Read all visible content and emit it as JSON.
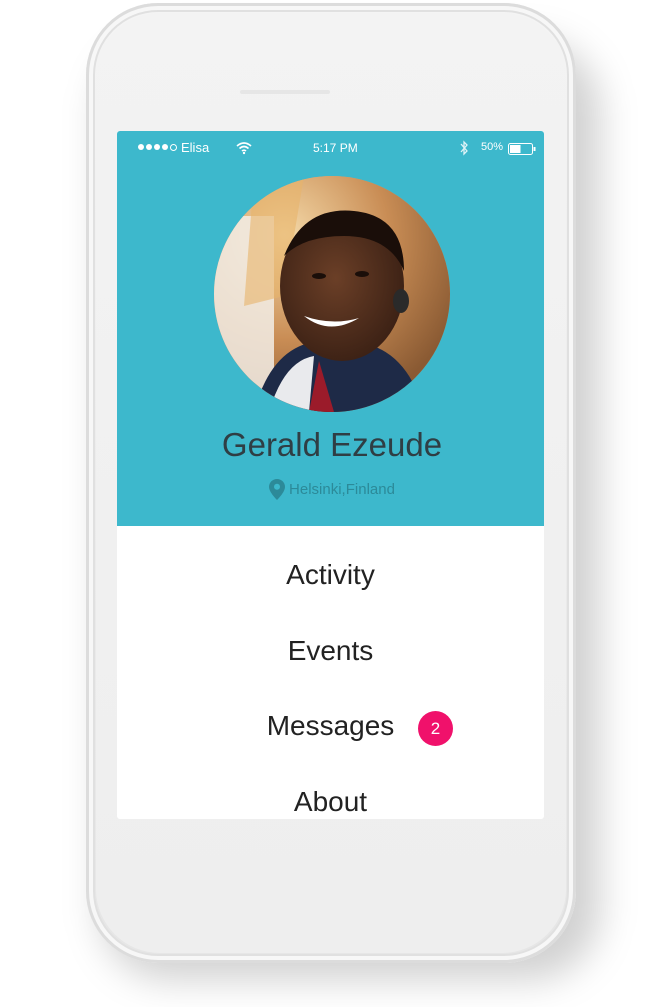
{
  "status_bar": {
    "carrier": "Elisa",
    "time": "5:17 PM",
    "battery_percent": "50%",
    "battery_level": 0.5,
    "icons": [
      "signal-dots-icon",
      "wifi-icon",
      "bluetooth-icon",
      "battery-icon"
    ]
  },
  "profile": {
    "name": "Gerald Ezeude",
    "location": "Helsinki,Finland",
    "location_icon": "map-pin-icon"
  },
  "menu": {
    "items": [
      {
        "label": "Activity"
      },
      {
        "label": "Events"
      },
      {
        "label": "Messages",
        "badge": "2"
      },
      {
        "label": "About"
      }
    ]
  },
  "colors": {
    "header": "#3db8cc",
    "badge": "#f0116b",
    "name_text": "#2f3e44",
    "location_text": "#2c8a99"
  }
}
